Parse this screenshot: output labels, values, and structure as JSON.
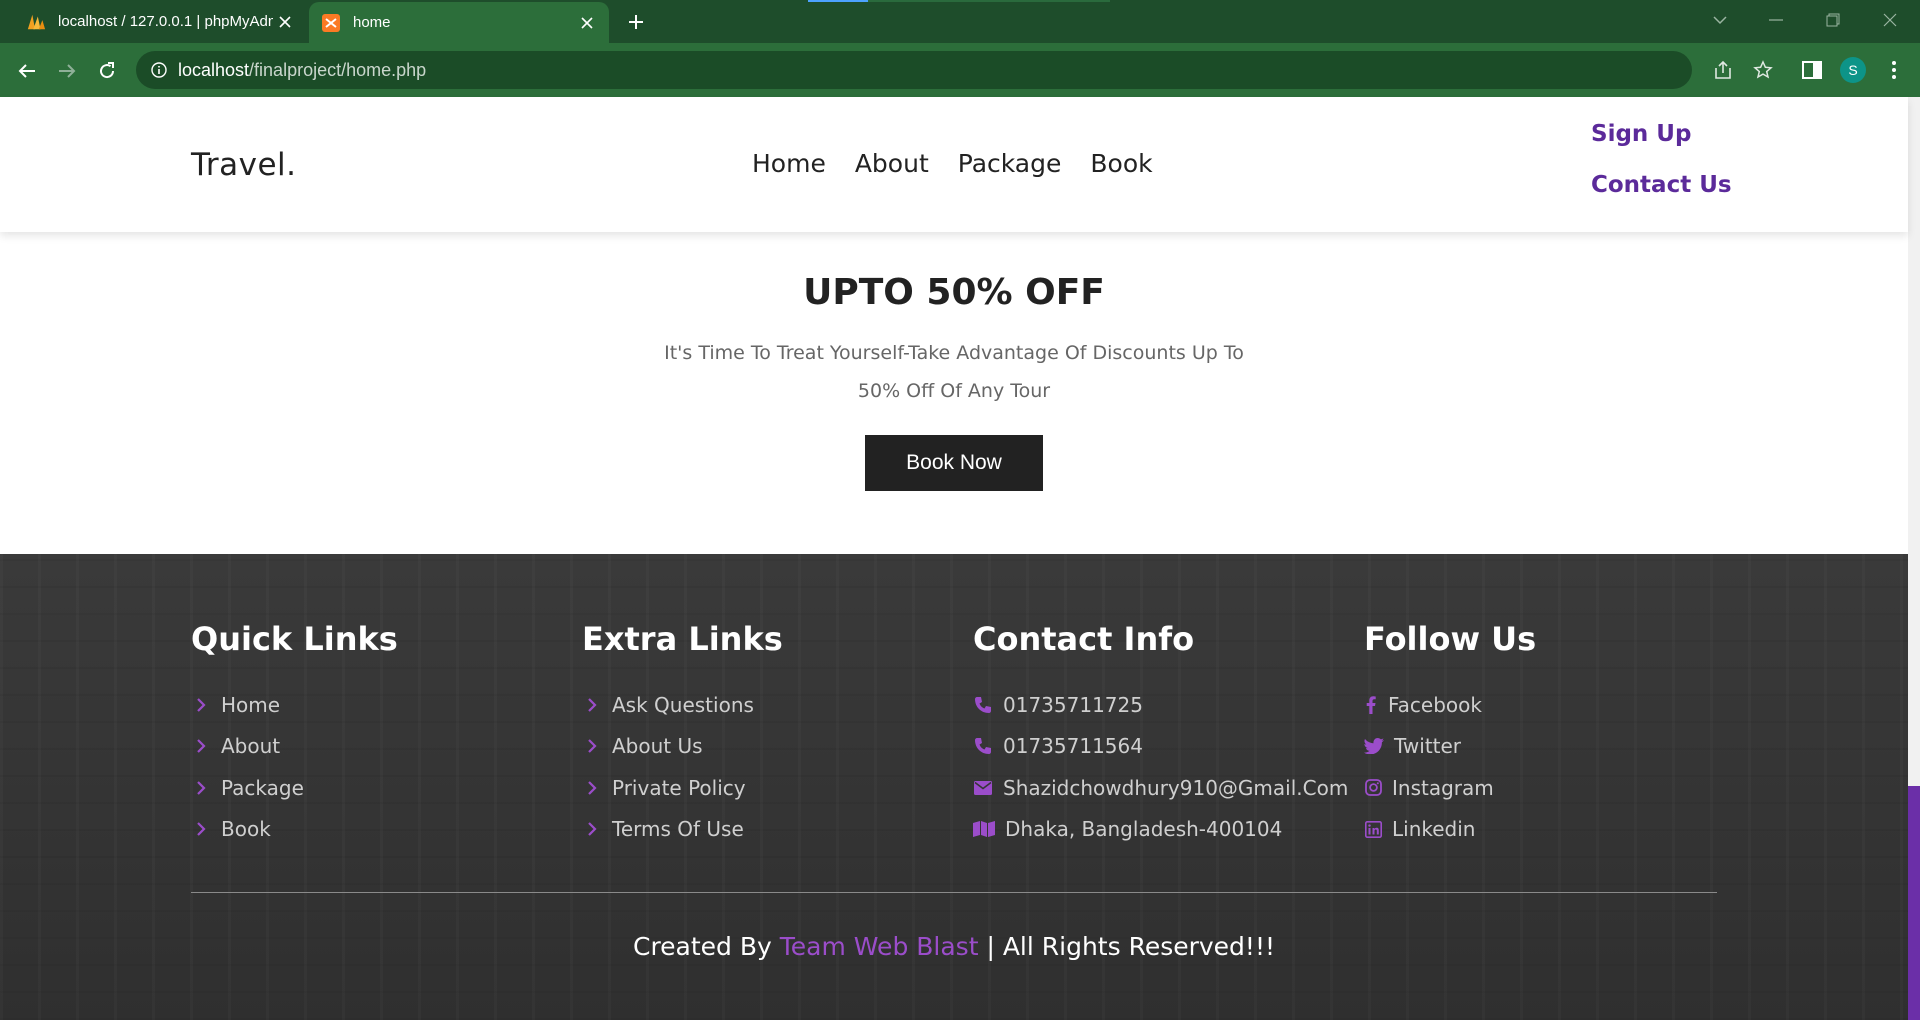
{
  "browser": {
    "tabs": [
      {
        "title": "localhost / 127.0.0.1 | phpMyAdmin",
        "icon": "phpmyadmin-favicon-icon",
        "active": false
      },
      {
        "title": "home",
        "icon": "xampp-favicon-icon",
        "active": true
      }
    ],
    "url_host": "localhost",
    "url_path": "/finalproject/home.php",
    "profile_initial": "S",
    "colors": {
      "tabbar": "#1e4d2b",
      "toolbar": "#2c6e3a"
    }
  },
  "header": {
    "logo": "Travel.",
    "nav": [
      "Home",
      "About",
      "Package",
      "Book"
    ],
    "sign_up": "Sign Up",
    "contact_us": "Contact Us"
  },
  "promo": {
    "heading": "UPTO 50% OFF",
    "text": "It's Time To Treat Yourself-Take Advantage Of Discounts Up To 50% Off Of Any Tour",
    "button": "Book Now"
  },
  "footer": {
    "quick_links": {
      "title": "Quick Links",
      "items": [
        "Home",
        "About",
        "Package",
        "Book"
      ]
    },
    "extra_links": {
      "title": "Extra Links",
      "items": [
        "Ask Questions",
        "About Us",
        "Private Policy",
        "Terms Of Use"
      ]
    },
    "contact_info": {
      "title": "Contact Info",
      "items": [
        {
          "icon": "phone-icon",
          "text": "01735711725"
        },
        {
          "icon": "phone-icon",
          "text": "01735711564"
        },
        {
          "icon": "envelope-icon",
          "text": "Shazidchowdhury910@Gmail.Com"
        },
        {
          "icon": "map-icon",
          "text": "Dhaka, Bangladesh-400104"
        }
      ]
    },
    "follow_us": {
      "title": "Follow Us",
      "items": [
        {
          "icon": "facebook-icon",
          "text": "Facebook"
        },
        {
          "icon": "twitter-icon",
          "text": "Twitter"
        },
        {
          "icon": "instagram-icon",
          "text": "Instagram"
        },
        {
          "icon": "linkedin-icon",
          "text": "Linkedin"
        }
      ]
    },
    "credit_prefix": "Created By",
    "credit_team": "Team Web Blast",
    "credit_suffix": "| All Rights Reserved!!!",
    "accent": "#9b4dca"
  }
}
